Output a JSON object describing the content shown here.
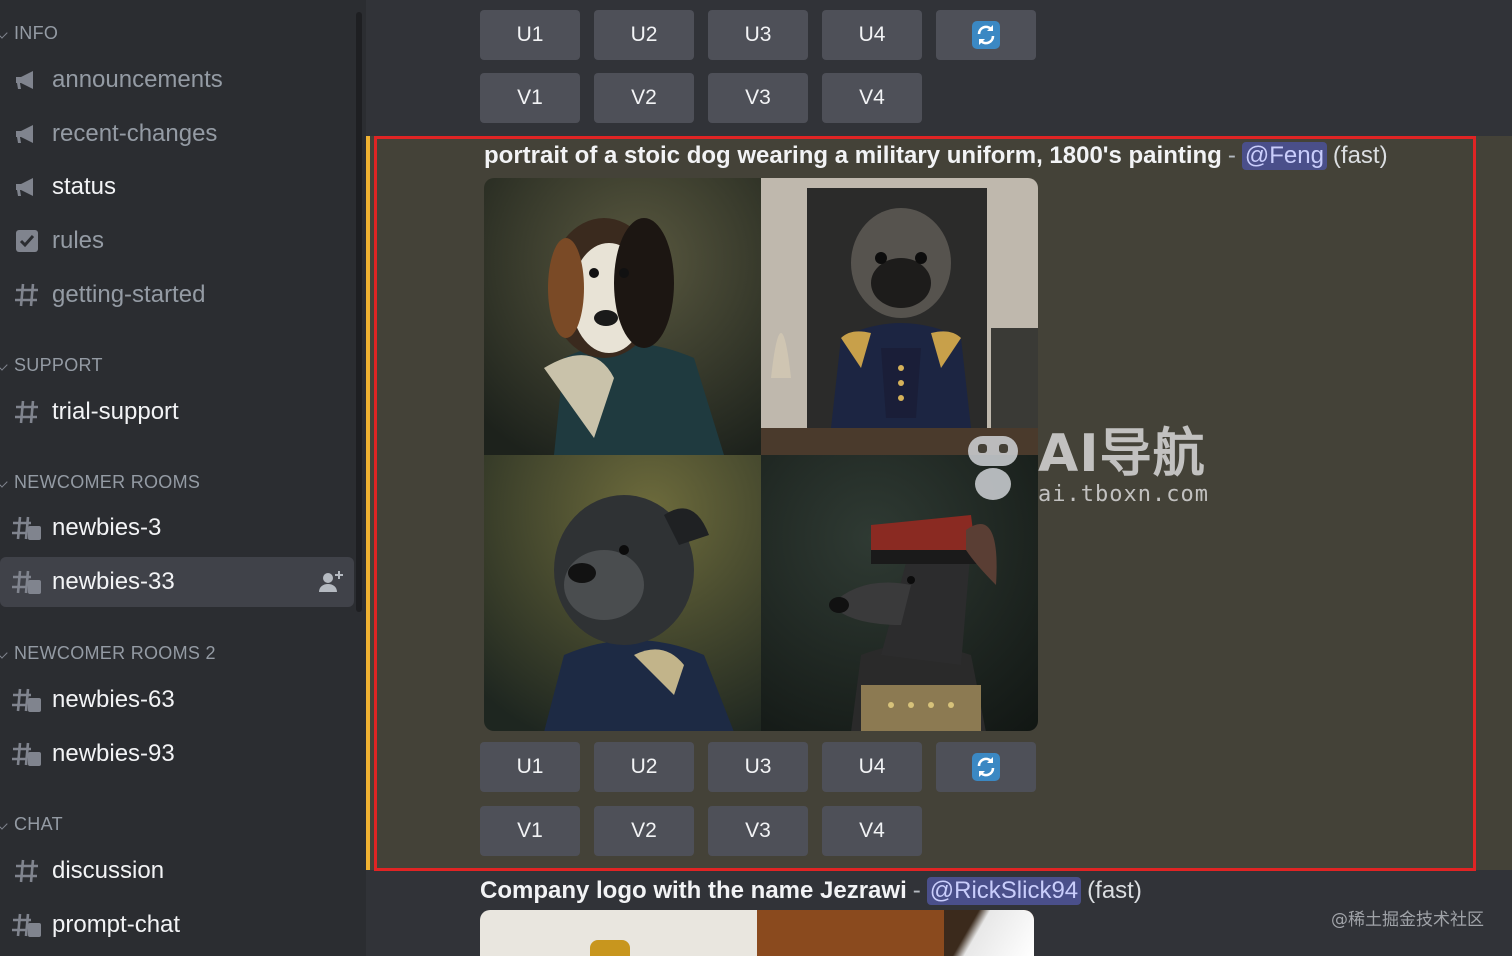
{
  "sidebar": {
    "categories": [
      {
        "label": "INFO"
      },
      {
        "label": "SUPPORT"
      },
      {
        "label": "NEWCOMER ROOMS"
      },
      {
        "label": "NEWCOMER ROOMS 2"
      },
      {
        "label": "CHAT"
      }
    ],
    "channels": [
      {
        "label": "announcements",
        "icon": "megaphone-icon"
      },
      {
        "label": "recent-changes",
        "icon": "megaphone-icon"
      },
      {
        "label": "status",
        "icon": "megaphone-icon"
      },
      {
        "label": "rules",
        "icon": "checkbox-icon"
      },
      {
        "label": "getting-started",
        "icon": "hash-icon"
      },
      {
        "label": "trial-support",
        "icon": "hash-icon"
      },
      {
        "label": "newbies-3",
        "icon": "hash-thread-icon"
      },
      {
        "label": "newbies-33",
        "icon": "hash-thread-icon",
        "active": true
      },
      {
        "label": "newbies-63",
        "icon": "hash-thread-icon"
      },
      {
        "label": "newbies-93",
        "icon": "hash-thread-icon"
      },
      {
        "label": "discussion",
        "icon": "hash-icon"
      },
      {
        "label": "prompt-chat",
        "icon": "hash-thread-icon"
      }
    ]
  },
  "buttons": {
    "u": [
      "U1",
      "U2",
      "U3",
      "U4"
    ],
    "v": [
      "V1",
      "V2",
      "V3",
      "V4"
    ],
    "refresh_icon": "refresh-icon"
  },
  "messages": [
    {
      "prompt": "portrait of a stoic dog wearing a military uniform, 1800's painting",
      "separator": "-",
      "mention": "@Feng",
      "speed": "(fast)"
    },
    {
      "prompt": "Company logo with the name Jezrawi",
      "separator": "-",
      "mention": "@RickSlick94",
      "speed": "(fast)"
    }
  ],
  "watermark": {
    "big": "AI导航",
    "small": "ai.tboxn.com"
  },
  "footer_mark": "@稀土掘金技术社区",
  "colors": {
    "accent_highlight": "#f0b232",
    "annotation_red": "#e02424",
    "mention_bg": "#4a4f8a"
  }
}
